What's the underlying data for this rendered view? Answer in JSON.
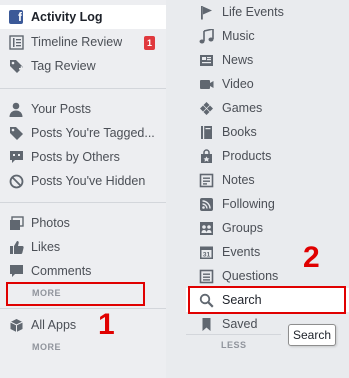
{
  "left_menu": {
    "activity_log": "Activity Log",
    "timeline_review": "Timeline Review",
    "timeline_review_count": "1",
    "tag_review": "Tag Review",
    "your_posts": "Your Posts",
    "posts_tagged": "Posts You're Tagged...",
    "posts_by_others": "Posts by Others",
    "posts_hidden": "Posts You've Hidden",
    "photos": "Photos",
    "likes": "Likes",
    "comments": "Comments",
    "more_label": "MORE",
    "all_apps": "All Apps",
    "apps_more_label": "MORE"
  },
  "right_menu": {
    "items": [
      {
        "label": "Life Events",
        "icon": "flag-icon"
      },
      {
        "label": "Music",
        "icon": "music-note-icon"
      },
      {
        "label": "News",
        "icon": "news-icon"
      },
      {
        "label": "Video",
        "icon": "video-icon"
      },
      {
        "label": "Games",
        "icon": "gamepad-icon"
      },
      {
        "label": "Books",
        "icon": "book-icon"
      },
      {
        "label": "Products",
        "icon": "shopping-bag-icon"
      },
      {
        "label": "Notes",
        "icon": "notes-icon"
      },
      {
        "label": "Following",
        "icon": "rss-icon"
      },
      {
        "label": "Groups",
        "icon": "groups-icon"
      },
      {
        "label": "Events",
        "icon": "calendar-icon"
      },
      {
        "label": "Questions",
        "icon": "questions-icon"
      },
      {
        "label": "Search",
        "icon": "search-icon"
      },
      {
        "label": "Saved",
        "icon": "bookmark-icon"
      }
    ],
    "less_label": "LESS",
    "tooltip": "Search",
    "calendar_day": "31"
  },
  "annotations": {
    "label_1": "1",
    "label_2": "2",
    "color": "#e00000"
  }
}
